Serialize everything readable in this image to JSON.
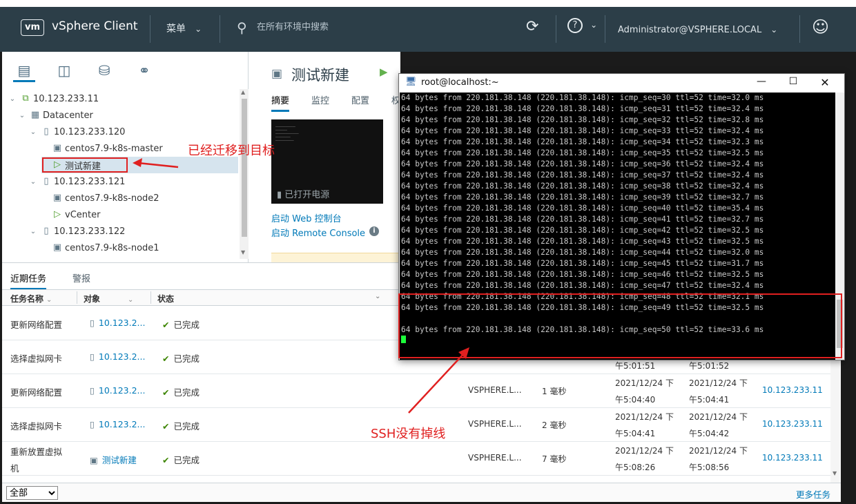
{
  "header": {
    "logo": "vm",
    "app_name": "vSphere Client",
    "menu_label": "菜单",
    "search_placeholder": "在所有环境中搜索",
    "user_label": "Administrator@VSPHERE.LOCAL",
    "icons": [
      "refresh-icon",
      "help-icon",
      "user-icon"
    ]
  },
  "inventory": {
    "tabs": [
      "hosts-clusters-icon",
      "vms-templates-icon",
      "storage-icon",
      "network-icon"
    ],
    "tree": [
      {
        "label": "10.123.233.11",
        "icon": "vcenter"
      },
      {
        "label": "Datacenter",
        "icon": "datacenter"
      },
      {
        "label": "10.123.233.120",
        "icon": "host"
      },
      {
        "label": "centos7.9-k8s-master",
        "icon": "vm"
      },
      {
        "label": "测试新建",
        "icon": "vm-on"
      },
      {
        "label": "10.123.233.121",
        "icon": "host"
      },
      {
        "label": "centos7.9-k8s-node2",
        "icon": "vm"
      },
      {
        "label": "vCenter",
        "icon": "vm-on"
      },
      {
        "label": "10.123.233.122",
        "icon": "host"
      },
      {
        "label": "centos7.9-k8s-node1",
        "icon": "vm"
      }
    ]
  },
  "detail": {
    "title": "测试新建",
    "tabs": [
      "摘要",
      "监控",
      "配置",
      "权"
    ],
    "power_state": "已打开电源",
    "link_web_console": "启动 Web 控制台",
    "link_remote_console": "启动 Remote Console"
  },
  "terminal": {
    "title": "root@localhost:~",
    "lines": [
      "64 bytes from 220.181.38.148 (220.181.38.148): icmp_seq=30 ttl=52 time=32.0 ms",
      "64 bytes from 220.181.38.148 (220.181.38.148): icmp_seq=31 ttl=52 time=32.4 ms",
      "64 bytes from 220.181.38.148 (220.181.38.148): icmp_seq=32 ttl=52 time=32.8 ms",
      "64 bytes from 220.181.38.148 (220.181.38.148): icmp_seq=33 ttl=52 time=32.4 ms",
      "64 bytes from 220.181.38.148 (220.181.38.148): icmp_seq=34 ttl=52 time=32.3 ms",
      "64 bytes from 220.181.38.148 (220.181.38.148): icmp_seq=35 ttl=52 time=32.5 ms",
      "64 bytes from 220.181.38.148 (220.181.38.148): icmp_seq=36 ttl=52 time=32.4 ms",
      "64 bytes from 220.181.38.148 (220.181.38.148): icmp_seq=37 ttl=52 time=32.4 ms",
      "64 bytes from 220.181.38.148 (220.181.38.148): icmp_seq=38 ttl=52 time=32.4 ms",
      "64 bytes from 220.181.38.148 (220.181.38.148): icmp_seq=39 ttl=52 time=32.7 ms",
      "64 bytes from 220.181.38.148 (220.181.38.148): icmp_seq=40 ttl=52 time=35.4 ms",
      "64 bytes from 220.181.38.148 (220.181.38.148): icmp_seq=41 ttl=52 time=32.7 ms",
      "64 bytes from 220.181.38.148 (220.181.38.148): icmp_seq=42 ttl=52 time=32.5 ms",
      "64 bytes from 220.181.38.148 (220.181.38.148): icmp_seq=43 ttl=52 time=32.5 ms",
      "64 bytes from 220.181.38.148 (220.181.38.148): icmp_seq=44 ttl=52 time=32.0 ms",
      "64 bytes from 220.181.38.148 (220.181.38.148): icmp_seq=45 ttl=52 time=31.7 ms",
      "64 bytes from 220.181.38.148 (220.181.38.148): icmp_seq=46 ttl=52 time=32.5 ms",
      "64 bytes from 220.181.38.148 (220.181.38.148): icmp_seq=47 ttl=52 time=32.4 ms",
      "64 bytes from 220.181.38.148 (220.181.38.148): icmp_seq=48 ttl=52 time=32.1 ms",
      "64 bytes from 220.181.38.148 (220.181.38.148): icmp_seq=49 ttl=52 time=32.5 ms",
      "",
      "64 bytes from 220.181.38.148 (220.181.38.148): icmp_seq=50 ttl=52 time=33.6 ms"
    ]
  },
  "tasks": {
    "tabs": [
      "近期任务",
      "警报"
    ],
    "columns": [
      "任务名称",
      "对象",
      "状态"
    ],
    "rows": [
      {
        "name": "更新网络配置",
        "object": "10.123.2...",
        "status": "已完成",
        "initiator": "",
        "queued": "",
        "start": [
          "",
          ""
        ],
        "complete": [
          "",
          ""
        ],
        "server": ""
      },
      {
        "name": "选择虚拟网卡",
        "object": "10.123.2...",
        "status": "已完成",
        "initiator": "",
        "queued": "",
        "start": [
          "",
          "午5:01:51"
        ],
        "complete": [
          "",
          "午5:01:52"
        ],
        "server": ""
      },
      {
        "name": "更新网络配置",
        "object": "10.123.2...",
        "status": "已完成",
        "initiator": "VSPHERE.L...",
        "queued": "1 毫秒",
        "start": [
          "2021/12/24 下",
          "午5:04:40"
        ],
        "complete": [
          "2021/12/24 下",
          "午5:04:41"
        ],
        "server": "10.123.233.11"
      },
      {
        "name": "选择虚拟网卡",
        "object": "10.123.2...",
        "status": "已完成",
        "initiator": "VSPHERE.L...",
        "queued": "2 毫秒",
        "start": [
          "2021/12/24 下",
          "午5:04:41"
        ],
        "complete": [
          "2021/12/24 下",
          "午5:04:42"
        ],
        "server": "10.123.233.11"
      },
      {
        "name": "重新放置虚拟",
        "name2": "机",
        "object": "测试新建",
        "status": "已完成",
        "initiator": "VSPHERE.L...",
        "queued": "7 毫秒",
        "start": [
          "2021/12/24 下",
          "午5:08:26"
        ],
        "complete": [
          "2021/12/24 下",
          "午5:08:56"
        ],
        "server": "10.123.233.11"
      }
    ],
    "filter_value": "全部",
    "more_link": "更多任务"
  },
  "annotations": {
    "migrated": "已经迁移到目标",
    "ssh": "SSH没有掉线"
  },
  "colors": {
    "header_bg": "#2c3e48",
    "accent": "#0079b8",
    "annotation_red": "#e02020",
    "success": "#3c8500"
  }
}
